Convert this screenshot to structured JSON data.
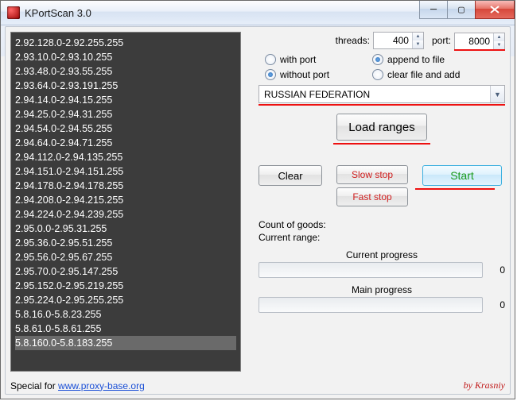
{
  "window": {
    "title": "KPortScan 3.0"
  },
  "ranges": [
    "2.92.128.0-2.92.255.255",
    "2.93.10.0-2.93.10.255",
    "2.93.48.0-2.93.55.255",
    "2.93.64.0-2.93.191.255",
    "2.94.14.0-2.94.15.255",
    "2.94.25.0-2.94.31.255",
    "2.94.54.0-2.94.55.255",
    "2.94.64.0-2.94.71.255",
    "2.94.112.0-2.94.135.255",
    "2.94.151.0-2.94.151.255",
    "2.94.178.0-2.94.178.255",
    "2.94.208.0-2.94.215.255",
    "2.94.224.0-2.94.239.255",
    "2.95.0.0-2.95.31.255",
    "2.95.36.0-2.95.51.255",
    "2.95.56.0-2.95.67.255",
    "2.95.70.0-2.95.147.255",
    "2.95.152.0-2.95.219.255",
    "2.95.224.0-2.95.255.255",
    "5.8.16.0-5.8.23.255",
    "5.8.61.0-5.8.61.255",
    "5.8.160.0-5.8.183.255"
  ],
  "selected_index": 21,
  "threads": {
    "label": "threads:",
    "value": "400"
  },
  "port": {
    "label": "port:",
    "value": "8000"
  },
  "options": {
    "with_port": "with port",
    "without_port": "without port",
    "append": "append to file",
    "clear_add": "clear file and add",
    "selected_left": "without_port",
    "selected_right": "append"
  },
  "country": {
    "value": "RUSSIAN FEDERATION"
  },
  "buttons": {
    "load": "Load ranges",
    "clear": "Clear",
    "slow": "Slow stop",
    "fast": "Fast stop",
    "start": "Start"
  },
  "stats": {
    "goods_label": "Count of goods:",
    "range_label": "Current range:"
  },
  "progress": {
    "current_label": "Current progress",
    "current_value": "0",
    "main_label": "Main progress",
    "main_value": "0"
  },
  "footer": {
    "prefix": "Special for ",
    "link": "www.proxy-base.org",
    "byline": "by Krasniy"
  }
}
